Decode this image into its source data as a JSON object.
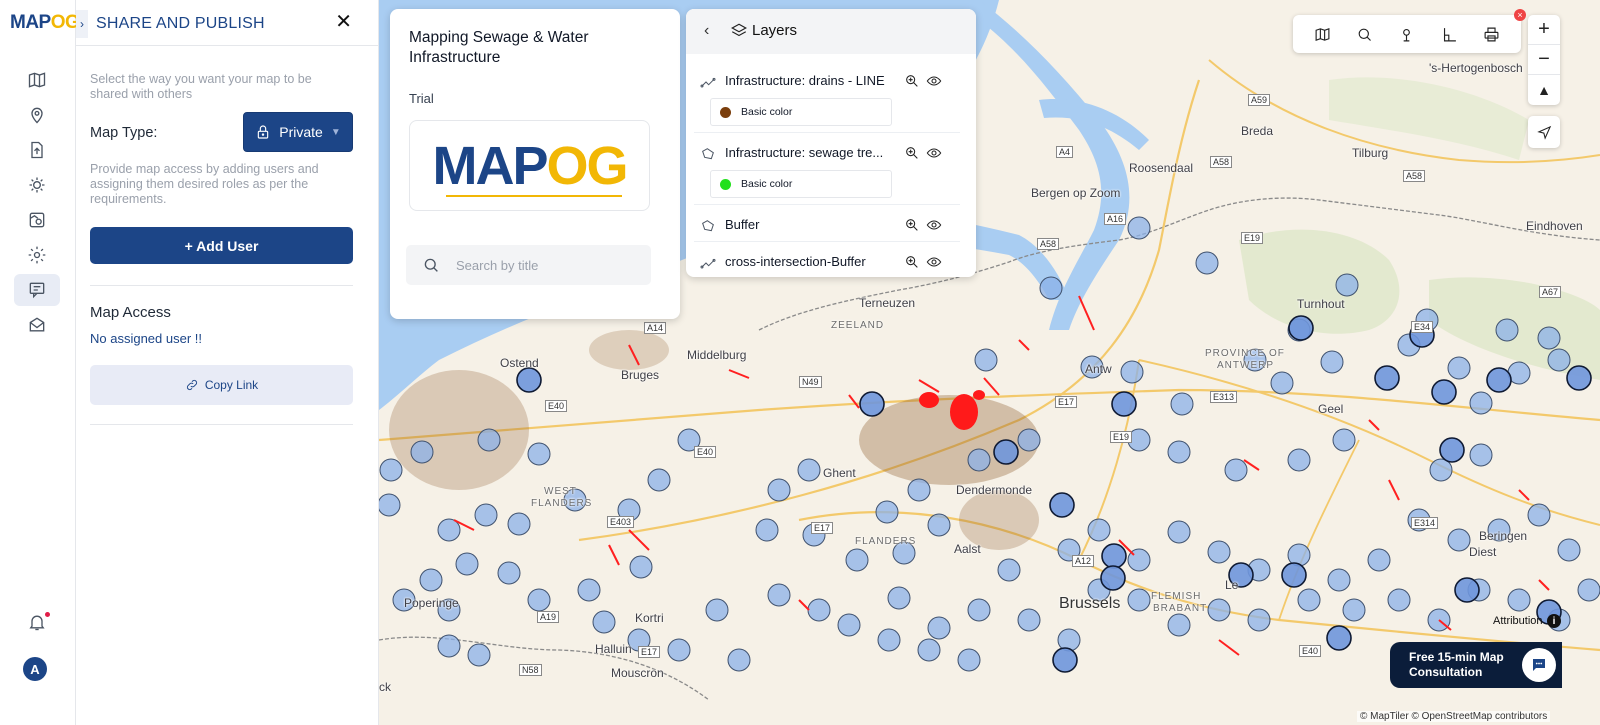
{
  "brand": {
    "name_main": "MAP",
    "name_accent": "OG"
  },
  "rail": {
    "items": [
      "map-icon",
      "location-pin-icon",
      "upload-icon",
      "sun-gear-icon",
      "map-settings-icon",
      "gear-icon",
      "share-icon",
      "map-mail-icon"
    ],
    "active": "share-icon",
    "avatar_initial": "A"
  },
  "share_panel": {
    "title": "SHARE AND PUBLISH",
    "subtitle": "Select the way you want your map to be shared with others",
    "map_type_label": "Map Type:",
    "map_type_value": "Private",
    "access_description": "Provide map access by adding users and assigning them desired roles as per the requirements.",
    "add_user_label": "+ Add User",
    "map_access_title": "Map Access",
    "no_user_text": "No assigned user !!",
    "copy_link_label": "Copy Link"
  },
  "project_card": {
    "title": "Mapping Sewage & Water Infrastructure",
    "subtitle": "Trial",
    "logo_main": "MAP",
    "logo_accent": "OG",
    "search_placeholder": "Search by title"
  },
  "layers_panel": {
    "title": "Layers",
    "layers": [
      {
        "name": "Infrastructure: drains - LINE",
        "color_label": "Basic color",
        "color": "#7a3e0c",
        "icon": "line-layer-icon"
      },
      {
        "name": "Infrastructure: sewage tre...",
        "color_label": "Basic color",
        "color": "#22e01c",
        "icon": "polygon-layer-icon"
      },
      {
        "name": "Buffer",
        "icon": "polygon-layer-icon"
      },
      {
        "name": "cross-intersection-Buffer",
        "icon": "line-layer-icon"
      }
    ]
  },
  "toolbar": {
    "tools": [
      "map-icon",
      "search-icon",
      "pin-icon",
      "measure-icon",
      "print-icon"
    ]
  },
  "map": {
    "places": {
      "hertogenbosch": "'s-Hertogenbosch",
      "breda": "Breda",
      "tilburg": "Tilburg",
      "roosendaal": "Roosendaal",
      "bergen": "Bergen op Zoom",
      "eindhoven": "Eindhoven",
      "terneuzen": "Terneuzen",
      "zeeland": "ZEELAND",
      "middelburg": "Middelburg",
      "turnhout": "Turnhout",
      "province_antwerp_1": "PROVINCE OF",
      "province_antwerp_2": "ANTWERP",
      "antwerp": "Antw",
      "ostend": "Ostend",
      "bruges": "Bruges",
      "geel": "Geel",
      "ghent": "Ghent",
      "dendermonde": "Dendermonde",
      "west_flanders_1": "WEST",
      "west_flanders_2": "FLANDERS",
      "flanders": "FLANDERS",
      "aalst": "Aalst",
      "beringen": "Beringen",
      "brussels": "Brussels",
      "flemish_brabant_1": "FLEMISH",
      "flemish_brabant_2": "BRABANT",
      "leuven": "Le",
      "poperinge": "Poperinge",
      "kortrijk": "Kortri",
      "halluin": "Halluin",
      "mouscron": "Mouscron",
      "diest": "Diest",
      "lille_fragment": "ck"
    },
    "roads": {
      "a59": "A59",
      "a4": "A4",
      "a58_1": "A58",
      "a58_2": "A58",
      "a16": "A16",
      "a58_3": "A58",
      "e19_1": "E19",
      "a67": "A67",
      "e34": "E34",
      "n49": "N49",
      "e40_1": "E40",
      "e17_1": "E17",
      "e19_2": "E19",
      "e313": "E313",
      "e40_2": "E40",
      "e403": "E403",
      "e17_2": "E17",
      "a12": "A12",
      "e314": "E314",
      "a19": "A19",
      "e17_3": "E17",
      "n58": "N58",
      "e40_3": "E40",
      "a14": "A14"
    }
  },
  "consultation": {
    "label": "Free 15-min Map Consultation"
  },
  "attribution": {
    "label": "Attribution",
    "copyright": "© MapTiler © OpenStreetMap contributors"
  }
}
